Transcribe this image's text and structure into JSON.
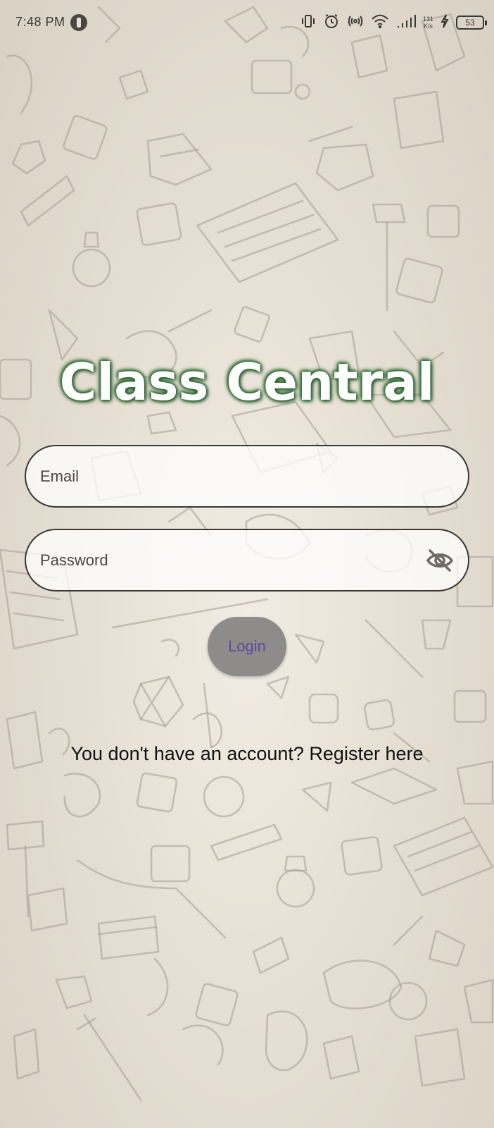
{
  "status_bar": {
    "time": "7:48 PM",
    "net_speed_value": "131",
    "net_speed_unit": "K/s",
    "battery": "53",
    "icons": [
      "app-notification-icon",
      "vibrate-icon",
      "alarm-icon",
      "hotspot-icon",
      "wifi-icon",
      "signal-icon",
      "charging-icon",
      "battery-icon"
    ]
  },
  "app": {
    "title": "Class Central"
  },
  "form": {
    "email_placeholder": "Email",
    "password_placeholder": "Password",
    "login_label": "Login",
    "register_text": "You don't have an account? Register here"
  },
  "colors": {
    "title_glow": "#2f6b34",
    "login_bg": "#8e8c8a",
    "login_text": "#5b4b9a",
    "background": "#e6dfd3"
  }
}
